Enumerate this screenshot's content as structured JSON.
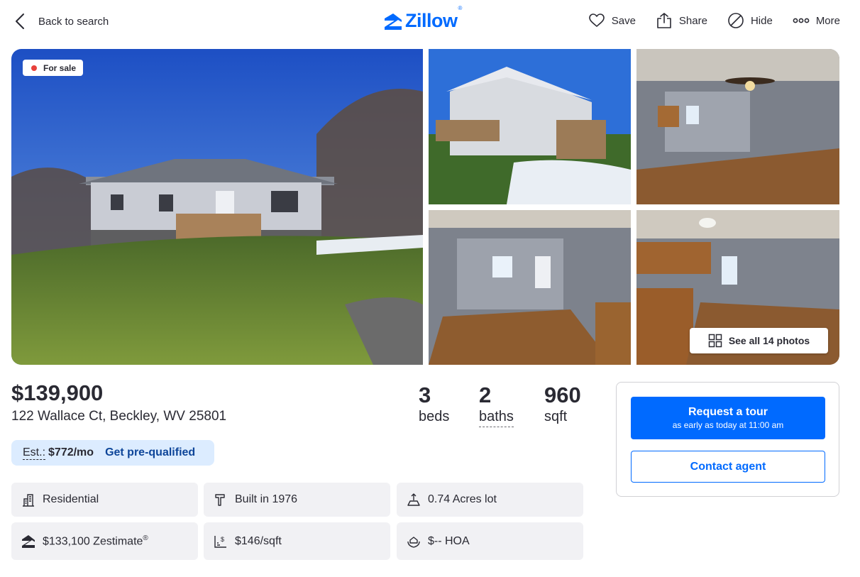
{
  "header": {
    "back_label": "Back to search",
    "logo_text": "Zillow",
    "logo_mark": "®",
    "actions": [
      {
        "label": "Save",
        "icon": "heart-icon"
      },
      {
        "label": "Share",
        "icon": "share-icon"
      },
      {
        "label": "Hide",
        "icon": "hide-icon"
      },
      {
        "label": "More",
        "icon": "more-icon"
      }
    ]
  },
  "gallery": {
    "status_badge": "For sale",
    "see_all_label": "See all 14 photos"
  },
  "listing": {
    "price": "$139,900",
    "address": "122 Wallace Ct, Beckley, WV 25801",
    "beds_value": "3",
    "beds_label": "beds",
    "baths_value": "2",
    "baths_label": "baths",
    "sqft_value": "960",
    "sqft_label": "sqft"
  },
  "estimate": {
    "label": "Est.:",
    "amount": "$772/mo",
    "prequal_link": "Get pre-qualified"
  },
  "facts": {
    "type": "Residential",
    "built": "Built in 1976",
    "lot": "0.74 Acres lot",
    "zestimate": "$133,100 Zestimate",
    "zestimate_mark": "®",
    "price_per_sqft": "$146/sqft",
    "hoa": "$-- HOA"
  },
  "contact_card": {
    "tour_label": "Request a tour",
    "tour_sub": "as early as today at 11:00 am",
    "contact_label": "Contact agent"
  },
  "colors": {
    "brand_blue": "#006aff",
    "est_bg": "#dcecff",
    "fact_bg": "#f1f1f4",
    "sale_dot": "#e8413b"
  }
}
